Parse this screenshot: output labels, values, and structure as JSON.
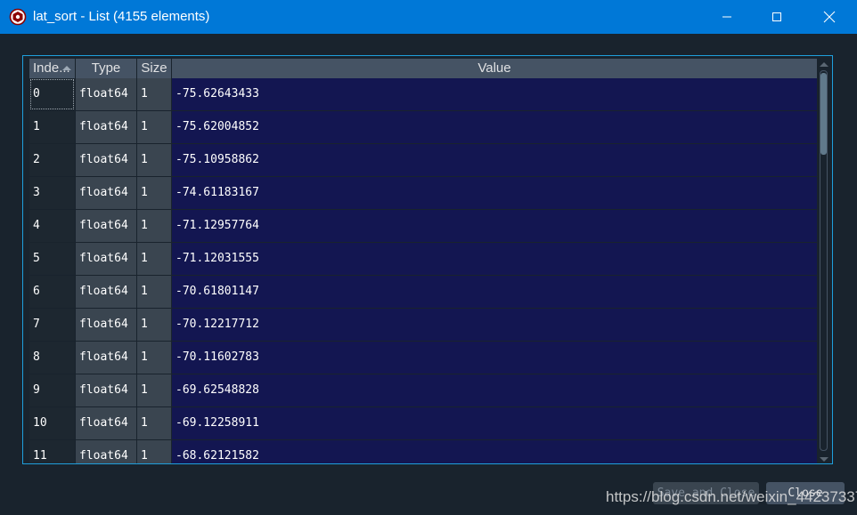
{
  "window": {
    "title": "lat_sort - List (4155 elements)",
    "icon": "spyder-icon",
    "controls": [
      "minimize-icon",
      "maximize-icon",
      "close-icon"
    ]
  },
  "table": {
    "columns": [
      "Inde...",
      "Type",
      "Size",
      "Value"
    ],
    "sorted_column": "Index",
    "rows": [
      {
        "index": "0",
        "type": "float64",
        "size": "1",
        "value": "-75.62643433"
      },
      {
        "index": "1",
        "type": "float64",
        "size": "1",
        "value": "-75.62004852"
      },
      {
        "index": "2",
        "type": "float64",
        "size": "1",
        "value": "-75.10958862"
      },
      {
        "index": "3",
        "type": "float64",
        "size": "1",
        "value": "-74.61183167"
      },
      {
        "index": "4",
        "type": "float64",
        "size": "1",
        "value": "-71.12957764"
      },
      {
        "index": "5",
        "type": "float64",
        "size": "1",
        "value": "-71.12031555"
      },
      {
        "index": "6",
        "type": "float64",
        "size": "1",
        "value": "-70.61801147"
      },
      {
        "index": "7",
        "type": "float64",
        "size": "1",
        "value": "-70.12217712"
      },
      {
        "index": "8",
        "type": "float64",
        "size": "1",
        "value": "-70.11602783"
      },
      {
        "index": "9",
        "type": "float64",
        "size": "1",
        "value": "-69.62548828"
      },
      {
        "index": "10",
        "type": "float64",
        "size": "1",
        "value": "-69.12258911"
      },
      {
        "index": "11",
        "type": "float64",
        "size": "1",
        "value": "-68.62121582"
      }
    ]
  },
  "buttons": {
    "save_close": "Save and Close",
    "close": "Close"
  },
  "watermark": "https://blog.csdn.net/weixin_44237337",
  "colors": {
    "titlebar": "#0078d7",
    "background": "#19232d",
    "header": "#455364",
    "value_cell": "#131651",
    "border_accent": "#1f9fdc"
  }
}
